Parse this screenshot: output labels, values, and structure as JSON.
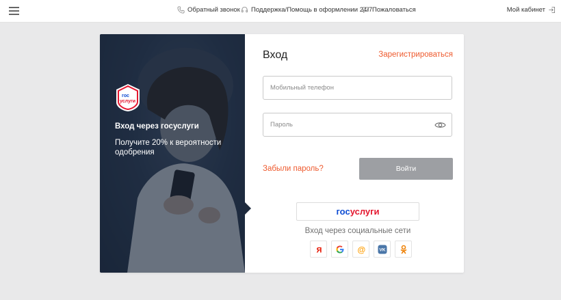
{
  "header": {
    "callback": "Обратный звонок",
    "support": "Поддержка/Помощь в оформлении 24/7",
    "complaint": "Пожаловаться",
    "cabinet": "Мой кабинет"
  },
  "promo": {
    "badge_line1": "гос",
    "badge_line2": "услуги",
    "title": "Вход через госуслуги",
    "text": "Получите 20% к вероятности одобрения"
  },
  "form": {
    "title": "Вход",
    "register": "Зарегистрироваться",
    "phone_placeholder": "Мобильный телефон",
    "password_placeholder": "Пароль",
    "forgot": "Забыли пароль?",
    "login": "Войти",
    "gos_part1": "гос",
    "gos_part2": "услуги",
    "social_title": "Вход через социальные сети"
  },
  "socials": [
    {
      "icon": "yandex-icon",
      "glyph": "Я",
      "color": "#e61400"
    },
    {
      "icon": "google-icon",
      "glyph": "G",
      "color": "#4285f4"
    },
    {
      "icon": "mailru-icon",
      "glyph": "@",
      "color": "#ff9e00"
    },
    {
      "icon": "vk-icon",
      "glyph": "VK",
      "color": "#4a76a8"
    },
    {
      "icon": "ok-icon",
      "glyph": "ok",
      "color": "#ee8208"
    }
  ],
  "colors": {
    "accent": "#ee5a2e",
    "button_disabled": "#9d9fa3",
    "promo_bg": "#1f2b3d"
  }
}
